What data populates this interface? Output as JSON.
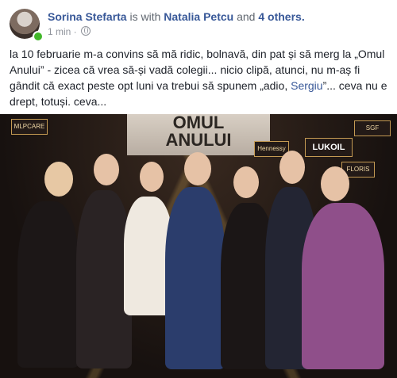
{
  "post": {
    "author": "Sorina Stefarta",
    "connector": " is with ",
    "tagged_person": "Natalia Petcu",
    "and_text": " and ",
    "others": "4 others.",
    "time": "1 min",
    "separator": " · ",
    "privacy_icon": "globe-icon",
    "body_before": "la 10 februarie m-a convins să mă ridic, bolnavă, din pat și să merg la „Omul Anului” - zicea că vrea să-și vadă colegii... nicio clipă, atunci, nu m-aș fi gândit că exact peste opt luni va trebui să spunem „adio, ",
    "mention": "Sergiu",
    "body_after": "”... ceva nu e drept, totuși. ceva..."
  },
  "photo": {
    "sign_line1": "OMUL",
    "sign_line2": "ANULUI",
    "logos": [
      "MLPCARE",
      "Hennessy",
      "LUKOIL",
      "SGF",
      "FLORIS"
    ],
    "accent": "#c49a53",
    "background": "#1a1413"
  }
}
